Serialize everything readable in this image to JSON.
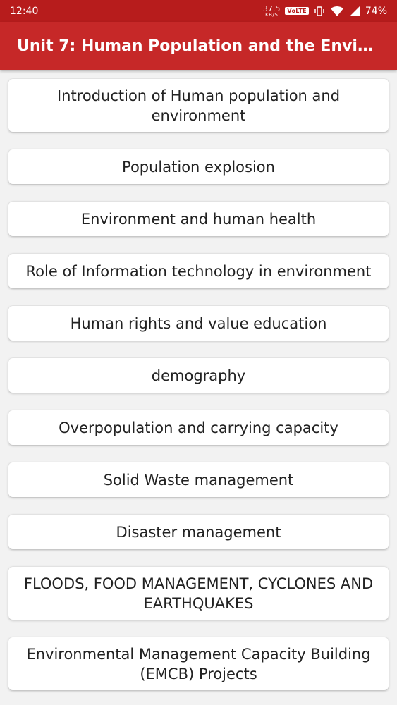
{
  "status_bar": {
    "time": "12:40",
    "net_speed": "37.5",
    "net_unit": "KB/S",
    "volte": "VoLTE",
    "battery": "74%"
  },
  "app_bar": {
    "title": "Unit 7: Human Population and the Environ..."
  },
  "topics": [
    "Introduction of Human population and environment",
    "Population explosion",
    "Environment and human health",
    "Role of Information technology in environment",
    "Human rights and value education",
    "demography",
    "Overpopulation and carrying capacity",
    "Solid Waste management",
    "Disaster management",
    "FLOODS, FOOD MANAGEMENT, CYCLONES AND EARTHQUAKES",
    "Environmental Management Capacity Building (EMCB) Projects"
  ],
  "colors": {
    "status_bar": "#b71c1c",
    "app_bar": "#c62828",
    "background": "#f2f2f2",
    "card": "#ffffff"
  },
  "icons": [
    "vibrate-icon",
    "wifi-icon",
    "signal-icon",
    "battery-icon"
  ]
}
